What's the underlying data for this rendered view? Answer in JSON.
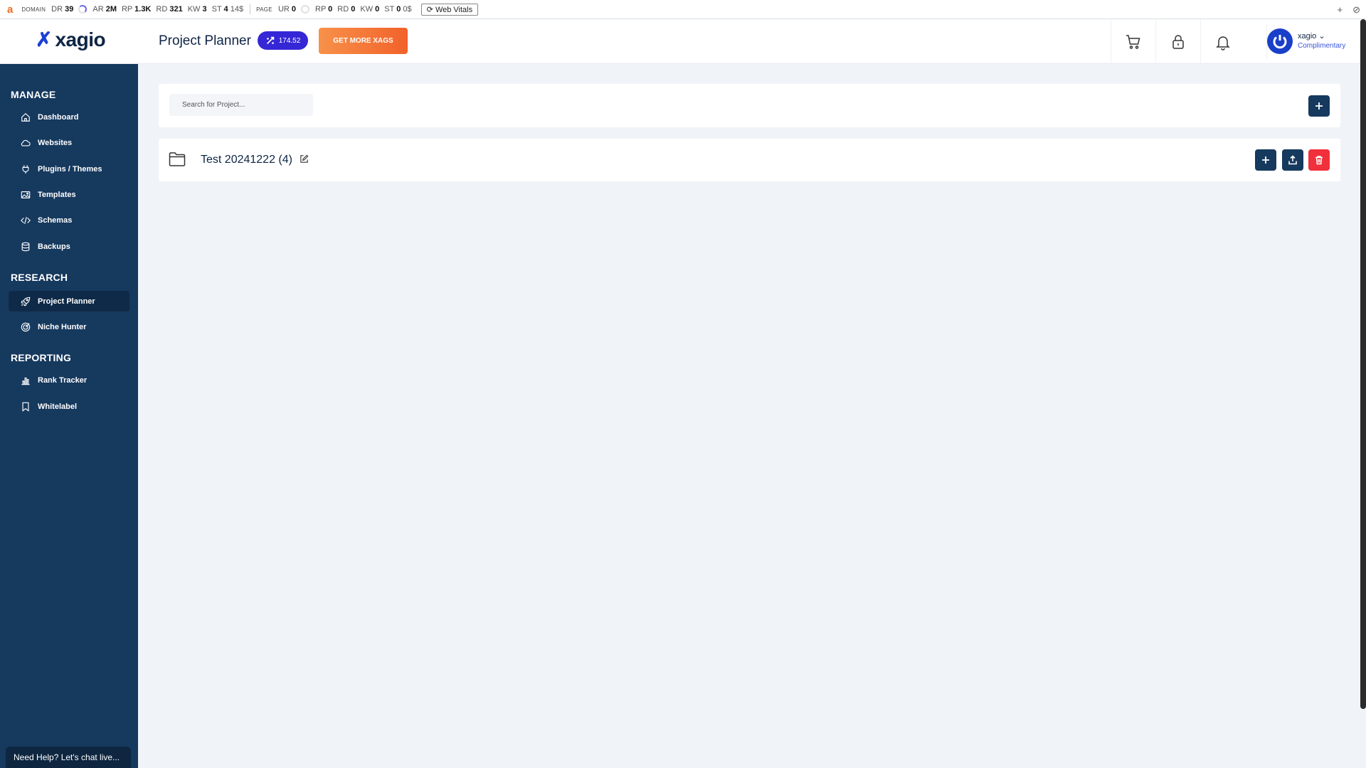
{
  "seo_bar": {
    "logo": "a",
    "domain_tag": "DOMAIN",
    "dr_label": "DR",
    "dr_value": "39",
    "ar_label": "AR",
    "ar_value": "2M",
    "rp_label": "RP",
    "rp_value": "1.3K",
    "rd_label": "RD",
    "rd_value": "321",
    "kw_label": "KW",
    "kw_value": "3",
    "st_label": "ST",
    "st_value": "4",
    "st_cost": "14$",
    "page_tag": "PAGE",
    "ur_label": "UR",
    "ur_value": "0",
    "prp_label": "RP",
    "prp_value": "0",
    "prd_label": "RD",
    "prd_value": "0",
    "pkw_label": "KW",
    "pkw_value": "0",
    "pst_label": "ST",
    "pst_value": "0",
    "pst_cost": "0$",
    "web_vitals": "Web Vitals",
    "plus": "+",
    "block": "⊘"
  },
  "header": {
    "logo_mark": "✗",
    "logo_text": "xagio",
    "page_title": "Project Planner",
    "xags_balance": "174.52",
    "get_more_label": "GET MORE XAGS",
    "user_name": "xagio",
    "user_plan": "Complimentary"
  },
  "sidebar": {
    "sections": {
      "manage": "MANAGE",
      "research": "RESEARCH",
      "reporting": "REPORTING"
    },
    "items": {
      "dashboard": "Dashboard",
      "websites": "Websites",
      "plugins": "Plugins / Themes",
      "templates": "Templates",
      "schemas": "Schemas",
      "backups": "Backups",
      "project_planner": "Project Planner",
      "niche_hunter": "Niche Hunter",
      "rank_tracker": "Rank Tracker",
      "whitelabel": "Whitelabel"
    },
    "help": "Need Help? Let's chat live..."
  },
  "main": {
    "search_placeholder": "Search for Project...",
    "projects": [
      {
        "name": "Test 20241222 (4)"
      }
    ]
  },
  "colors": {
    "sidebar_bg": "#16395e",
    "accent_blue": "#3527d6",
    "orange": "#f2622a",
    "danger": "#f0303a"
  }
}
